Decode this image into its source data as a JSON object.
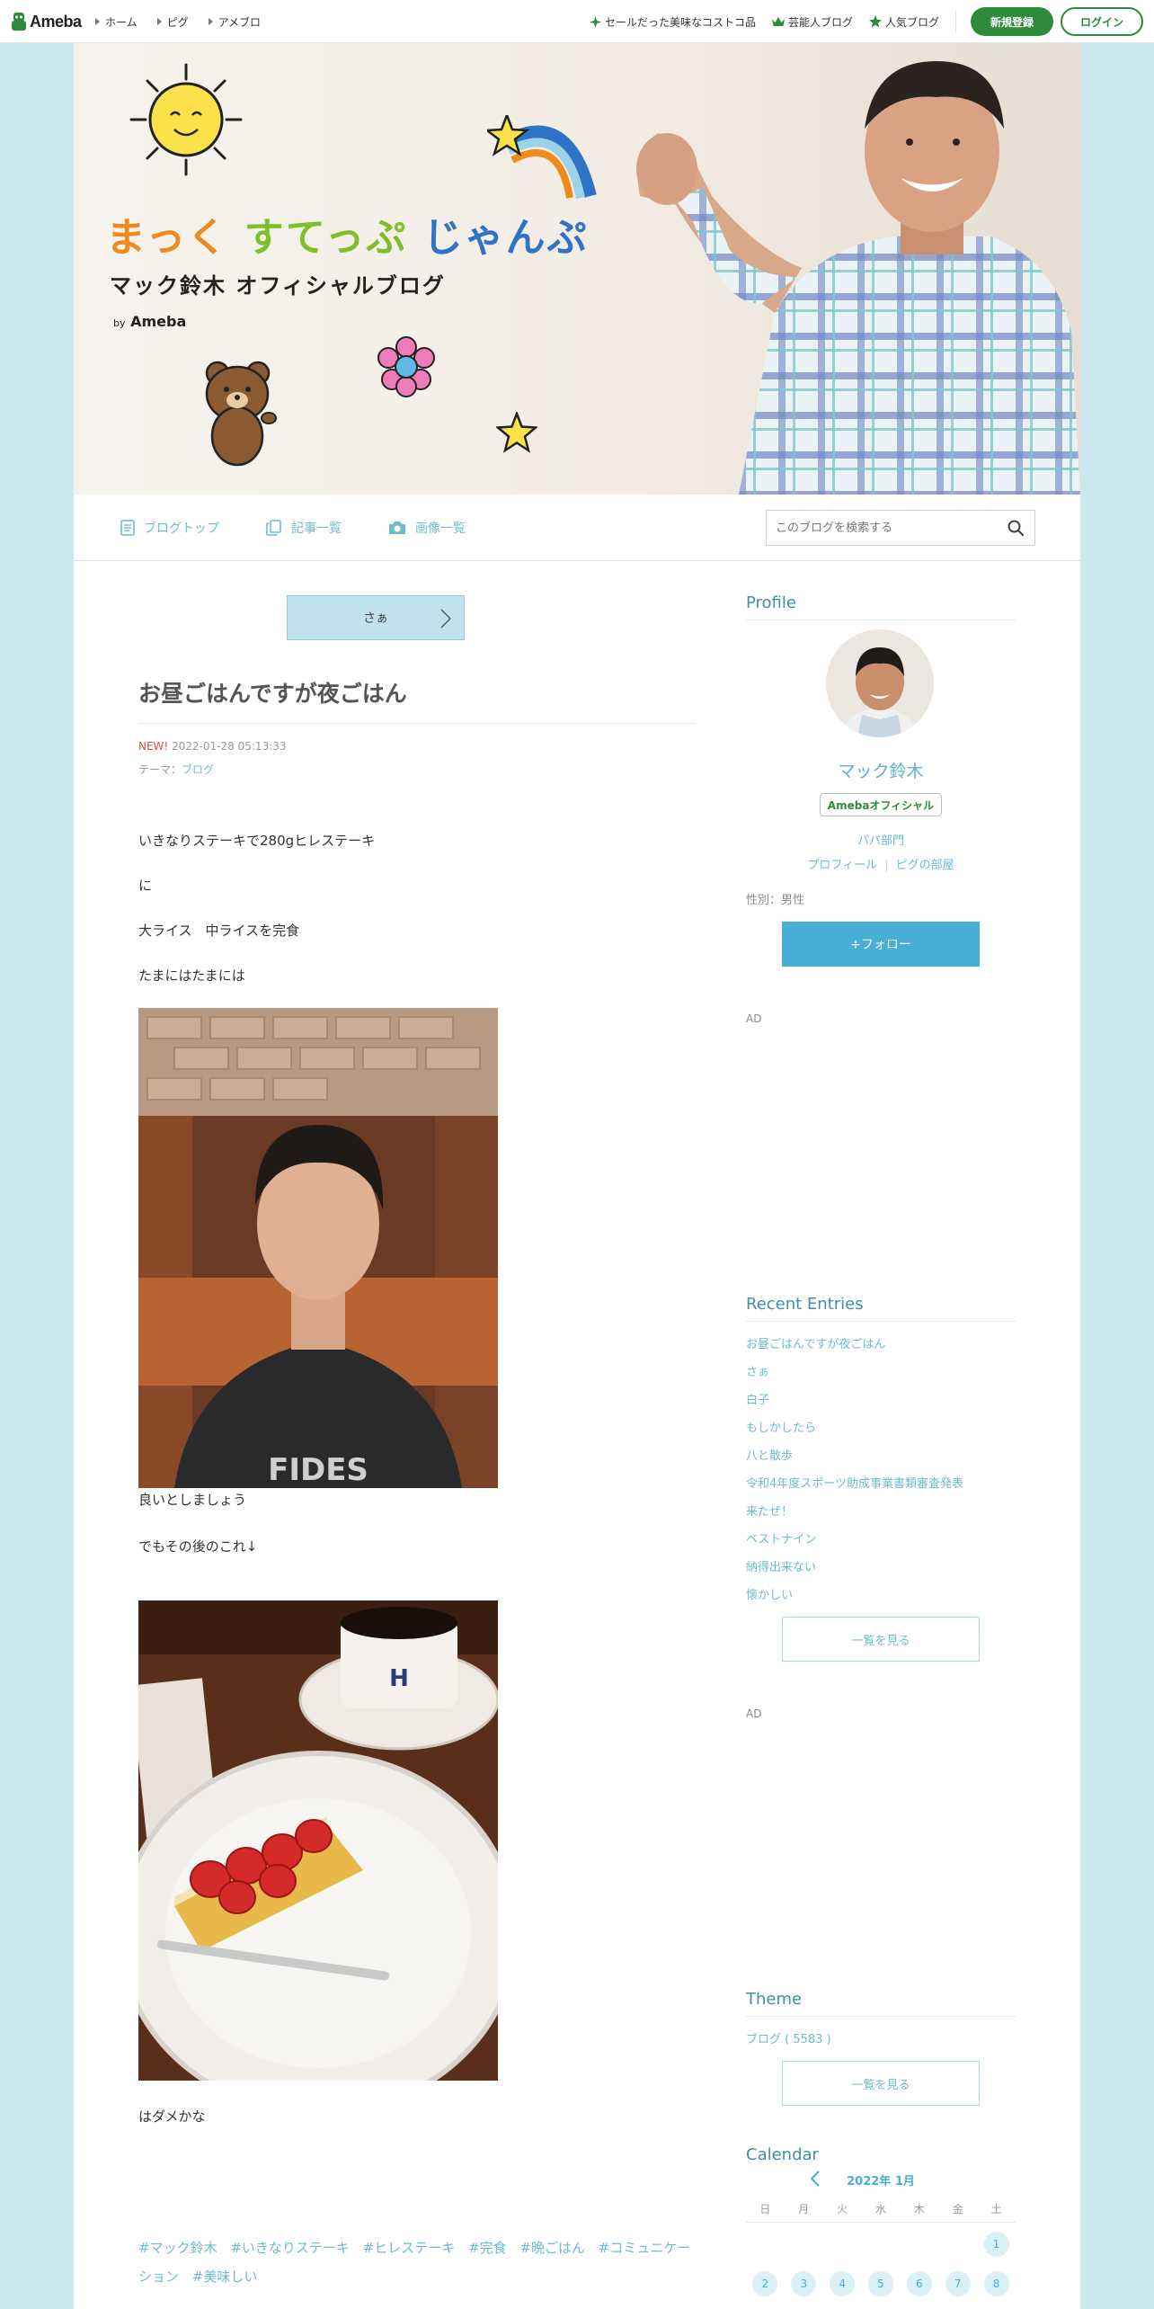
{
  "global_nav": {
    "brand": "Ameba",
    "links": [
      "ホーム",
      "ピグ",
      "アメブロ"
    ],
    "right_links": [
      "セールだった美味なコストコ品",
      "芸能人ブログ",
      "人気ブログ"
    ],
    "register_label": "新規登録",
    "login_label": "ログイン"
  },
  "banner": {
    "title_part1": "まっく ",
    "title_part2": "すてっぷ ",
    "title_part3": "じゃんぷ",
    "subtitle": "マック鈴木 オフィシャルブログ",
    "by": "by",
    "by_brand": "Ameba"
  },
  "blog_nav": {
    "items": [
      "ブログトップ",
      "記事一覧",
      "画像一覧"
    ],
    "search_placeholder": "このブログを検索する"
  },
  "article": {
    "prev_label": "さぁ",
    "title": "お昼ごはんですが夜ごはん",
    "new_label": "NEW!",
    "datetime": "2022-01-28 05:13:33",
    "theme_prefix": "テーマ：",
    "theme": "ブログ",
    "paragraphs": [
      "いきなりステーキで280gヒレステーキ",
      "に",
      "大ライス　中ライスを完食",
      "たまにはたまには",
      "良いとしましょう",
      "でもその後のこれ↓",
      "はダメかな"
    ],
    "tags": [
      "#マック鈴木",
      "#いきなりステーキ",
      "#ヒレステーキ",
      "#完食",
      "#晩ごはん",
      "#コミュニケーション",
      "#美味しい"
    ]
  },
  "sidebar": {
    "profile_heading": "Profile",
    "name": "マック鈴木",
    "official_badge": "Amebaオフィシャル",
    "category": "パパ部門",
    "profile_link": "プロフィール",
    "pig_link": "ピグの部屋",
    "gender": "性別：男性",
    "follow_label": "+フォロー",
    "ad_label": "AD",
    "recent_heading": "Recent Entries",
    "recent_entries": [
      "お昼ごはんですが夜ごはん",
      "さぁ",
      "白子",
      "もしかしたら",
      "八と散歩",
      "令和4年度スポーツ助成事業書類審査発表",
      "来たぜ！",
      "ベストナイン",
      "納得出来ない",
      "懐かしい"
    ],
    "see_all_label": "一覧を見る",
    "theme_heading": "Theme",
    "theme_item": "ブログ ( 5583 )",
    "calendar_heading": "Calendar",
    "calendar_month": "2022年 1月",
    "weekdays": [
      "日",
      "月",
      "火",
      "水",
      "木",
      "金",
      "土"
    ],
    "week1": [
      "",
      "",
      "",
      "",
      "",
      "",
      "1"
    ],
    "week2": [
      "2",
      "3",
      "4",
      "5",
      "6",
      "7",
      "8"
    ]
  },
  "colors": {
    "accent_blue": "#47aed4",
    "link_blue": "#6bbcd0",
    "brand_green": "#2d8c3c",
    "page_bg": "#cde7ef"
  }
}
